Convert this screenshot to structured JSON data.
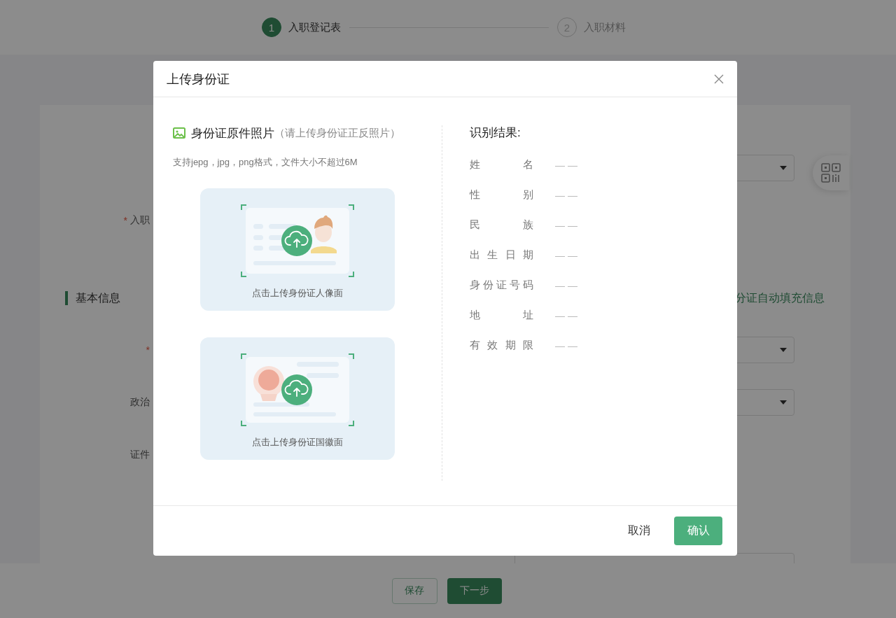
{
  "steps": [
    {
      "number": "1",
      "label": "入职登记表",
      "selected": true
    },
    {
      "number": "2",
      "label": "入职材料",
      "selected": false
    }
  ],
  "form": [
    {
      "kind": "select"
    },
    {
      "kind": "text",
      "required_mark": "*",
      "label": "入职"
    },
    {
      "kind": "section",
      "title": "基本信息",
      "link": "分证自动填充信息"
    },
    {
      "kind": "select",
      "required_mark": "*"
    },
    {
      "kind": "select",
      "label": "政治"
    },
    {
      "kind": "text",
      "label": "证件"
    },
    {
      "kind": "field"
    }
  ],
  "footer_buttons": [
    {
      "label": "保存",
      "kind": "secondary"
    },
    {
      "label": "下一步",
      "kind": "primary"
    }
  ],
  "dialog": {
    "title": "上传身份证",
    "upload": {
      "title": "身份证原件照片",
      "hint": "（请上传身份证正反照片）",
      "formats": "支持jepg，jpg，png格式，文件大小不超过6M",
      "cards": [
        {
          "kind": "portrait",
          "label": "点击上传身份证人像面"
        },
        {
          "kind": "emblem",
          "label": "点击上传身份证国徽面"
        }
      ]
    },
    "results": {
      "title": "识别结果:",
      "rows": [
        {
          "label": "姓名",
          "value": "— —"
        },
        {
          "label": "性别",
          "value": "— —"
        },
        {
          "label": "民族",
          "value": "— —"
        },
        {
          "label": "出生日期",
          "value": "— —"
        },
        {
          "label": "身份证号码",
          "value": "— —"
        },
        {
          "label": "地址",
          "value": "— —"
        },
        {
          "label": "有效期限",
          "value": "— —"
        }
      ]
    },
    "buttons": [
      {
        "label": "取消",
        "kind": "secondary"
      },
      {
        "label": "确认",
        "kind": "primary"
      }
    ]
  }
}
